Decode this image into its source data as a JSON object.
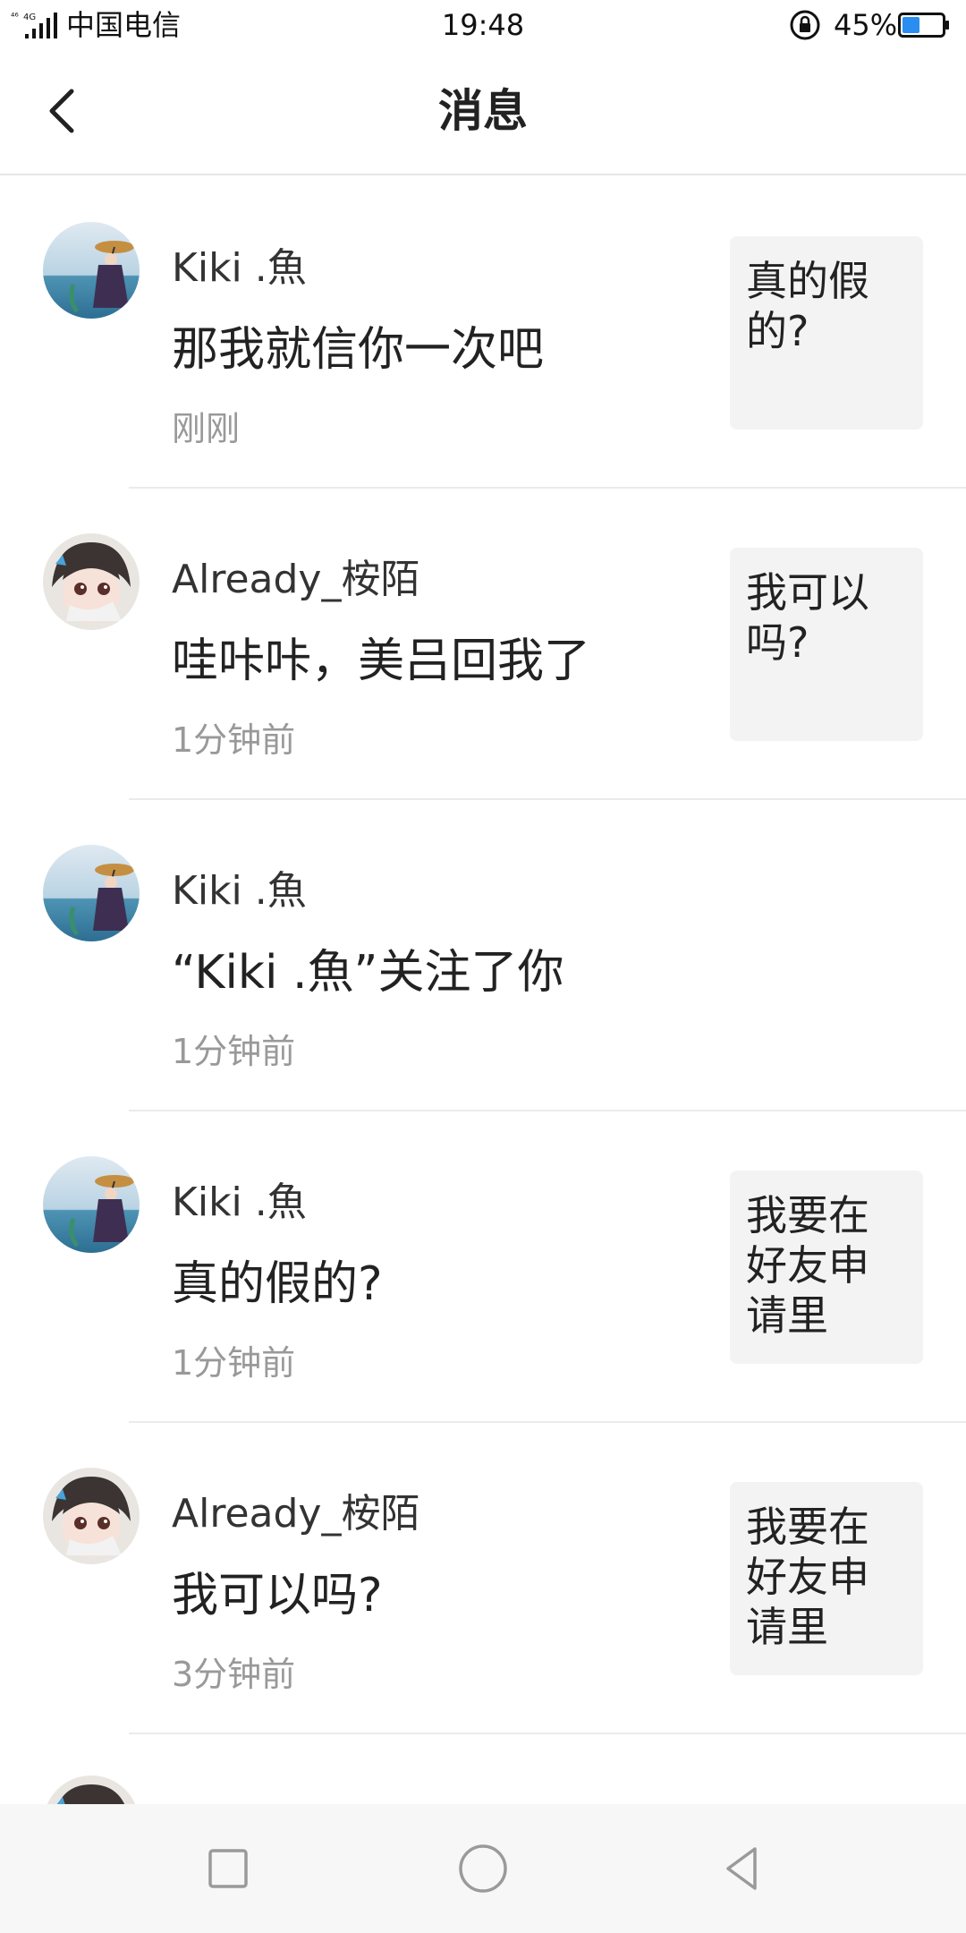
{
  "status_bar": {
    "carrier": "中国电信",
    "time": "19:48",
    "battery": "45%",
    "battery_level": 0.45,
    "network": "4G"
  },
  "header": {
    "title": "消息",
    "back_icon": "chevron-left-icon"
  },
  "messages": [
    {
      "name": "Kiki .魚",
      "text": "那我就信你一次吧",
      "time": "刚刚",
      "preview": "真的假的?",
      "avatar": "girl-umbrella-avatar"
    },
    {
      "name": "Already_桉陌",
      "text": "哇咔咔，美吕回我了",
      "time": "1分钟前",
      "preview": "我可以吗?",
      "avatar": "anime-boy-avatar"
    },
    {
      "name": "Kiki .魚",
      "text": "“Kiki .魚”关注了你",
      "time": "1分钟前",
      "preview": "",
      "avatar": "girl-umbrella-avatar"
    },
    {
      "name": "Kiki .魚",
      "text": "真的假的?",
      "time": "1分钟前",
      "preview": "我要在好友申请里抽…",
      "avatar": "girl-umbrella-avatar"
    },
    {
      "name": "Already_桉陌",
      "text": "我可以吗?",
      "time": "3分钟前",
      "preview": "我要在好友申请里抽…",
      "avatar": "anime-boy-avatar"
    }
  ],
  "nav_bar": {
    "recents_icon": "square-icon",
    "home_icon": "circle-icon",
    "back_icon": "triangle-back-icon"
  }
}
